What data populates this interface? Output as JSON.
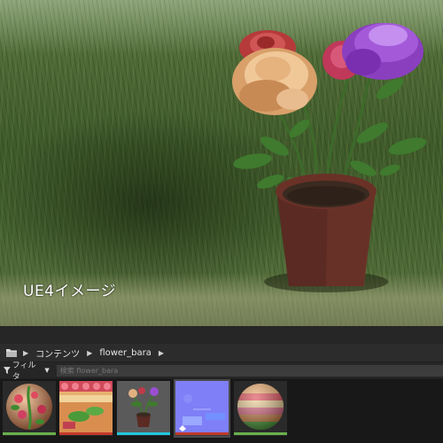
{
  "viewport": {
    "caption": "UE4イメージ"
  },
  "content_browser": {
    "breadcrumb": [
      {
        "label": "コンテンツ"
      },
      {
        "label": "flower_bara"
      }
    ],
    "filter_label": "フィルタ",
    "search_placeholder": "検索 flower_bara",
    "assets": [
      {
        "icon": "material-sphere-icon",
        "bar_color": "#6ab04c"
      },
      {
        "icon": "texture-icon",
        "bar_color": "#c0392b"
      },
      {
        "icon": "static-mesh-icon",
        "bar_color": "#21c7d9"
      },
      {
        "icon": "normal-map-icon",
        "bar_color": "#c0392b",
        "selected": true
      },
      {
        "icon": "material-sphere-icon",
        "bar_color": "#6ab04c"
      }
    ]
  },
  "colors": {
    "panel_bg": "#202020",
    "toolbar_bg": "#2c2c2c",
    "material_bar": "#6ab04c",
    "texture_bar": "#c0392b",
    "mesh_bar": "#21c7d9"
  }
}
